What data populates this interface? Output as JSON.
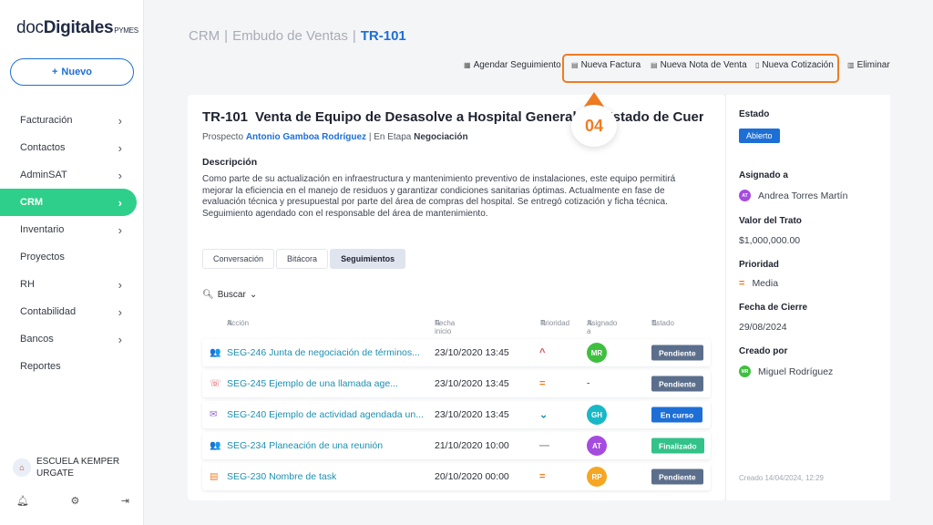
{
  "logo": {
    "part1": "doc",
    "part2": "Digitales",
    "suffix": "PYMES"
  },
  "new_button": {
    "icon": "+",
    "label": "Nuevo"
  },
  "nav": [
    {
      "label": "Facturación",
      "chevron": true
    },
    {
      "label": "Contactos",
      "chevron": true
    },
    {
      "label": "AdminSAT",
      "chevron": true
    },
    {
      "label": "CRM",
      "chevron": true,
      "active": true
    },
    {
      "label": "Inventario",
      "chevron": true
    },
    {
      "label": "Proyectos",
      "chevron": false
    },
    {
      "label": "RH",
      "chevron": true
    },
    {
      "label": "Contabilidad",
      "chevron": true
    },
    {
      "label": "Bancos",
      "chevron": true
    },
    {
      "label": "Reportes",
      "chevron": false
    }
  ],
  "org": {
    "line1": "ESCUELA KEMPER",
    "line2": "URGATE"
  },
  "breadcrumb": {
    "crm": "CRM",
    "funnel": "Embudo de Ventas",
    "current": "TR-101",
    "sep": "|"
  },
  "toolbar": {
    "schedule": "Agendar Seguimiento",
    "invoice": "Nueva Factura",
    "sale_note": "Nueva Nota de Venta",
    "quote": "Nueva Cotización",
    "delete": "Eliminar"
  },
  "step_number": "04",
  "deal": {
    "code": "TR-101",
    "title": "Venta de Equipo de Desasolve a Hospital General del Estado de Cuerna...",
    "prospect_label": "Prospecto",
    "prospect_name": "Antonio Gamboa Rodríguez",
    "stage_prefix": "| En Etapa",
    "stage": "Negociación",
    "description_heading": "Descripción",
    "description": "Como parte de su actualización en infraestructura y mantenimiento preventivo de instalaciones, este equipo permitirá mejorar la eficiencia en el manejo de residuos y garantizar condiciones sanitarias óptimas. Actualmente en fase de evaluación técnica y presupuestal por parte del área de compras del hospital. Se entregó cotización y ficha técnica. Seguimiento agendado con el responsable del área de mantenimiento."
  },
  "tabs": [
    "Conversación",
    "Bitácora",
    "Seguimientos"
  ],
  "active_tab": 2,
  "search_label": "Buscar",
  "columns": {
    "action": "Acción",
    "start": "Fecha inicio",
    "priority": "Prioridad",
    "assigned": "Asignado a",
    "status": "Estado"
  },
  "rows": [
    {
      "icon": "meeting-icon",
      "glyph": "👥",
      "action": "SEG-246 Junta de negociación de términos...",
      "date": "23/10/2020 13:45",
      "priority": "^",
      "priority_color": "#e0474c",
      "assignee": "MR",
      "assignee_color": "#3fbf3f",
      "status": "Pendiente",
      "status_color": "#5b6f8c"
    },
    {
      "icon": "call-icon",
      "glyph": "☏",
      "action": "SEG-245 Ejemplo de una llamada age...",
      "date": "23/10/2020 13:45",
      "priority": "=",
      "priority_color": "#f07c22",
      "assignee": "-",
      "assignee_color": "",
      "status": "Pendiente",
      "status_color": "#5b6f8c"
    },
    {
      "icon": "email-icon",
      "glyph": "✉",
      "action": "SEG-240 Ejemplo de actividad agendada un...",
      "date": "23/10/2020 13:45",
      "priority": "⌄",
      "priority_color": "#1d8fb0",
      "assignee": "GH",
      "assignee_color": "#19b8c6",
      "status": "En curso",
      "status_color": "#1d6fd6"
    },
    {
      "icon": "meeting-icon",
      "glyph": "👥",
      "action": "SEG-234 Planeación de una reunión",
      "date": "21/10/2020 10:00",
      "priority": "—",
      "priority_color": "#8a8f99",
      "assignee": "AT",
      "assignee_color": "#a64be0",
      "status": "Finalizado",
      "status_color": "#33c28a"
    },
    {
      "icon": "task-icon",
      "glyph": "▤",
      "action": "SEG-230 Nombre de task",
      "date": "20/10/2020 00:00",
      "priority": "=",
      "priority_color": "#f07c22",
      "assignee": "RP",
      "assignee_color": "#f5a623",
      "status": "Pendiente",
      "status_color": "#5b6f8c"
    }
  ],
  "details": {
    "estado_label": "Estado",
    "estado": "Abierto",
    "assigned_label": "Asignado a",
    "assigned_initials": "AT",
    "assigned_name": "Andrea Torres Martín",
    "value_label": "Valor del Trato",
    "value": "$1,000,000.00",
    "priority_label": "Prioridad",
    "priority": "Media",
    "close_label": "Fecha de Cierre",
    "close_date": "29/08/2024",
    "created_by_label": "Creado por",
    "created_by_initials": "MR",
    "created_by": "Miguel Rodríguez",
    "created_at": "Creado 14/04/2024, 12:29"
  },
  "colors": {
    "accent": "#1d6fd6",
    "active_nav": "#2ecf8a",
    "highlight": "#f07c22"
  }
}
